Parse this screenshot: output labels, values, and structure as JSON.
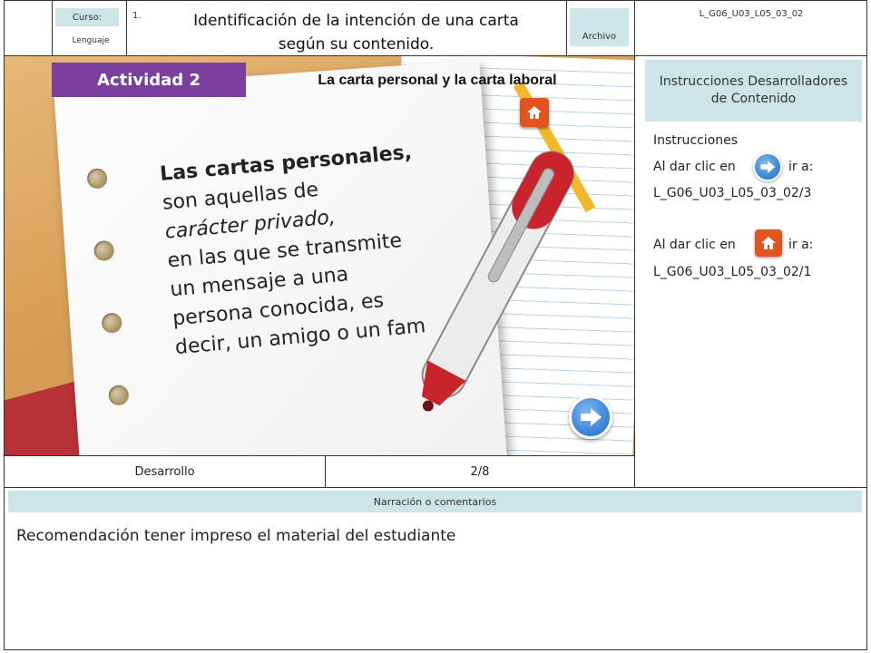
{
  "header": {
    "curso_label": "Curso:",
    "curso_value": "Lenguaje",
    "number": "1.",
    "title": "Identificación de la intención de una carta según su contenido.",
    "archivo_label": "Archivo",
    "code": "L_G06_U03_L05_03_02"
  },
  "slide": {
    "activity_label": "Actividad 2",
    "activity_title": "La carta personal y la carta laboral",
    "lines": [
      "Las cartas personales,",
      "son aquellas de",
      "carácter privado,",
      "en las que se transmite",
      "un mensaje a una",
      "persona conocida, es",
      "decir, un amigo o un fam"
    ]
  },
  "sidebar": {
    "title": "Instrucciones Desarrolladores de Contenido",
    "instructions_label": "Instrucciones",
    "click_prefix": "Al dar clic en",
    "goto": "ir a:",
    "next_target": "L_G06_U03_L05_03_02/3",
    "home_target": "L_G06_U03_L05_03_02/1"
  },
  "footer": {
    "stage": "Desarrollo",
    "page": "2/8"
  },
  "narration": {
    "label": "Narración o comentarios",
    "text": "Recomendación tener impreso el material del estudiante"
  },
  "colors": {
    "activity": "#7b3fa0",
    "tag_bg": "#cde4e9",
    "home_button": "#e2531f",
    "next_button": "#3b84d6"
  },
  "icons": [
    "home-icon",
    "next-arrow-icon",
    "pen-illustration"
  ]
}
